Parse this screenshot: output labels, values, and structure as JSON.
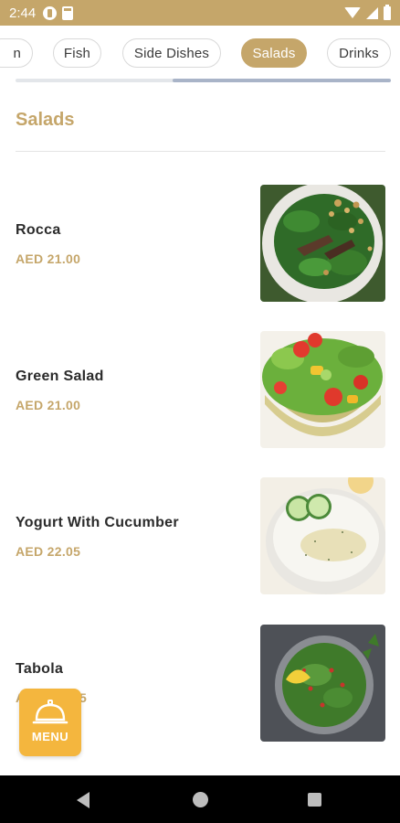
{
  "status_bar": {
    "time": "2:44"
  },
  "tabs": [
    {
      "label": "n",
      "active": false
    },
    {
      "label": "Fish",
      "active": false
    },
    {
      "label": "Side Dishes",
      "active": false
    },
    {
      "label": "Salads",
      "active": true
    },
    {
      "label": "Drinks",
      "active": false
    }
  ],
  "section": {
    "title": "Salads"
  },
  "items": [
    {
      "name": "Rocca",
      "price": "AED 21.00",
      "image": "rocca-salad-photo"
    },
    {
      "name": "Green Salad",
      "price": "AED 21.00",
      "image": "green-salad-photo"
    },
    {
      "name": "Yogurt With Cucumber",
      "price": "AED 22.05",
      "image": "yogurt-cucumber-photo"
    },
    {
      "name": "Tabola",
      "price": "A",
      "price_tail": "5",
      "image": "tabbouleh-photo"
    }
  ],
  "menu_button": {
    "label": "MENU",
    "icon": "cloche-icon"
  },
  "colors": {
    "accent": "#c5a66a",
    "fab": "#f4b63e",
    "nav": "#000000"
  }
}
